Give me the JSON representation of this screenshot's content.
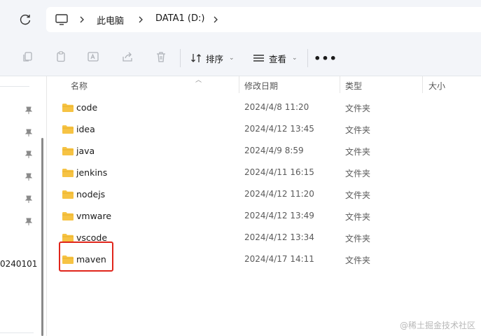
{
  "addressbar": {
    "breadcrumb": [
      "此电脑",
      "DATA1 (D:)"
    ]
  },
  "toolbar": {
    "sort_label": "排序",
    "view_label": "查看",
    "more_label": "•••"
  },
  "navpane": {
    "partial_label": "0240101"
  },
  "columns": {
    "name": "名称",
    "modified": "修改日期",
    "type": "类型",
    "size": "大小"
  },
  "files": [
    {
      "name": "code",
      "modified": "2024/4/8 11:20",
      "type": "文件夹"
    },
    {
      "name": "idea",
      "modified": "2024/4/12 13:45",
      "type": "文件夹"
    },
    {
      "name": "java",
      "modified": "2024/4/9 8:59",
      "type": "文件夹"
    },
    {
      "name": "jenkins",
      "modified": "2024/4/11 16:15",
      "type": "文件夹"
    },
    {
      "name": "nodejs",
      "modified": "2024/4/12 11:20",
      "type": "文件夹"
    },
    {
      "name": "vmware",
      "modified": "2024/4/12 13:49",
      "type": "文件夹"
    },
    {
      "name": "vscode",
      "modified": "2024/4/12 13:34",
      "type": "文件夹"
    },
    {
      "name": "maven",
      "modified": "2024/4/17 14:11",
      "type": "文件夹"
    }
  ],
  "watermark": "@稀土掘金技术社区",
  "colors": {
    "folder": "#f6c344",
    "highlight": "#e0251b",
    "chrome_bg": "#f3f5f9"
  }
}
